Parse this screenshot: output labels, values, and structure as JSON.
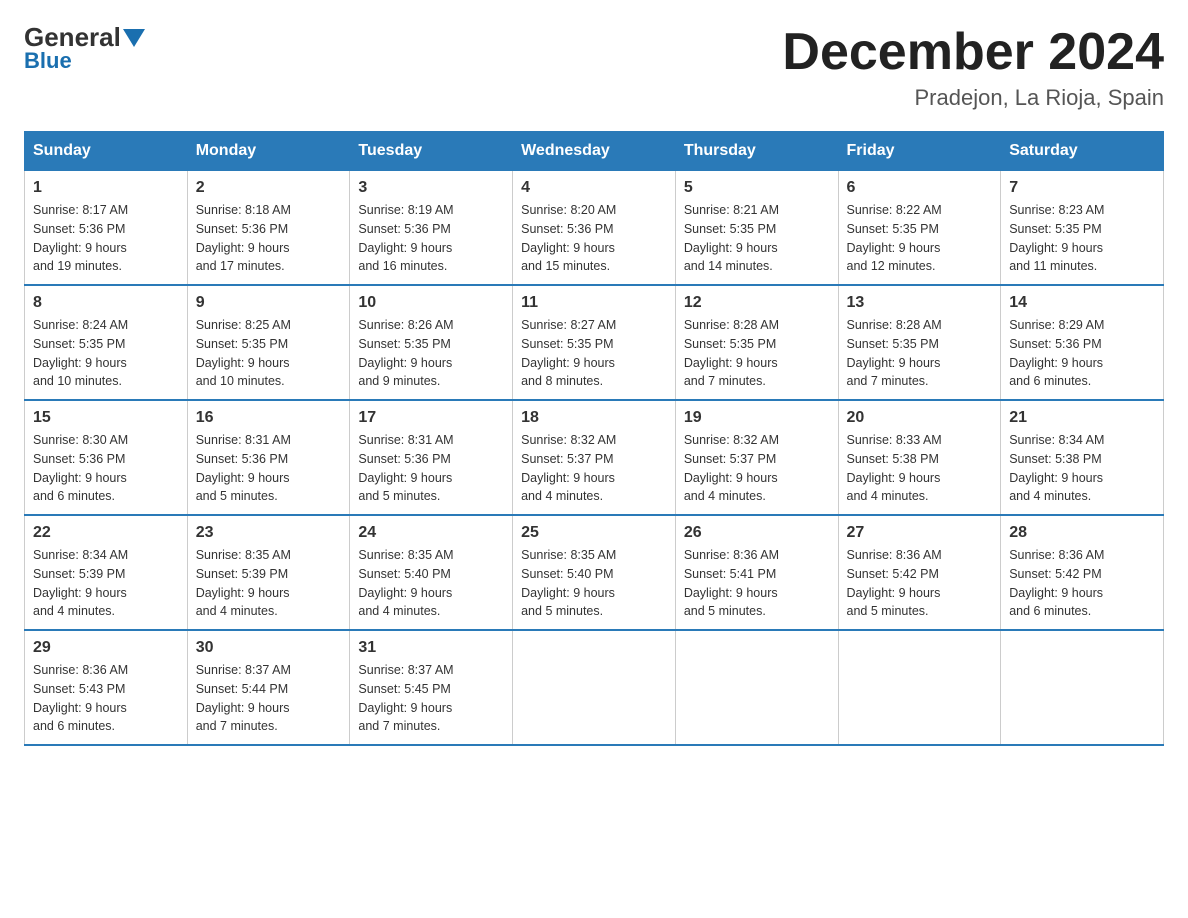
{
  "logo": {
    "general": "General",
    "blue": "Blue"
  },
  "header": {
    "month": "December 2024",
    "location": "Pradejon, La Rioja, Spain"
  },
  "days_of_week": [
    "Sunday",
    "Monday",
    "Tuesday",
    "Wednesday",
    "Thursday",
    "Friday",
    "Saturday"
  ],
  "weeks": [
    [
      {
        "day": "1",
        "sunrise": "8:17 AM",
        "sunset": "5:36 PM",
        "daylight": "9 hours and 19 minutes."
      },
      {
        "day": "2",
        "sunrise": "8:18 AM",
        "sunset": "5:36 PM",
        "daylight": "9 hours and 17 minutes."
      },
      {
        "day": "3",
        "sunrise": "8:19 AM",
        "sunset": "5:36 PM",
        "daylight": "9 hours and 16 minutes."
      },
      {
        "day": "4",
        "sunrise": "8:20 AM",
        "sunset": "5:36 PM",
        "daylight": "9 hours and 15 minutes."
      },
      {
        "day": "5",
        "sunrise": "8:21 AM",
        "sunset": "5:35 PM",
        "daylight": "9 hours and 14 minutes."
      },
      {
        "day": "6",
        "sunrise": "8:22 AM",
        "sunset": "5:35 PM",
        "daylight": "9 hours and 12 minutes."
      },
      {
        "day": "7",
        "sunrise": "8:23 AM",
        "sunset": "5:35 PM",
        "daylight": "9 hours and 11 minutes."
      }
    ],
    [
      {
        "day": "8",
        "sunrise": "8:24 AM",
        "sunset": "5:35 PM",
        "daylight": "9 hours and 10 minutes."
      },
      {
        "day": "9",
        "sunrise": "8:25 AM",
        "sunset": "5:35 PM",
        "daylight": "9 hours and 10 minutes."
      },
      {
        "day": "10",
        "sunrise": "8:26 AM",
        "sunset": "5:35 PM",
        "daylight": "9 hours and 9 minutes."
      },
      {
        "day": "11",
        "sunrise": "8:27 AM",
        "sunset": "5:35 PM",
        "daylight": "9 hours and 8 minutes."
      },
      {
        "day": "12",
        "sunrise": "8:28 AM",
        "sunset": "5:35 PM",
        "daylight": "9 hours and 7 minutes."
      },
      {
        "day": "13",
        "sunrise": "8:28 AM",
        "sunset": "5:35 PM",
        "daylight": "9 hours and 7 minutes."
      },
      {
        "day": "14",
        "sunrise": "8:29 AM",
        "sunset": "5:36 PM",
        "daylight": "9 hours and 6 minutes."
      }
    ],
    [
      {
        "day": "15",
        "sunrise": "8:30 AM",
        "sunset": "5:36 PM",
        "daylight": "9 hours and 6 minutes."
      },
      {
        "day": "16",
        "sunrise": "8:31 AM",
        "sunset": "5:36 PM",
        "daylight": "9 hours and 5 minutes."
      },
      {
        "day": "17",
        "sunrise": "8:31 AM",
        "sunset": "5:36 PM",
        "daylight": "9 hours and 5 minutes."
      },
      {
        "day": "18",
        "sunrise": "8:32 AM",
        "sunset": "5:37 PM",
        "daylight": "9 hours and 4 minutes."
      },
      {
        "day": "19",
        "sunrise": "8:32 AM",
        "sunset": "5:37 PM",
        "daylight": "9 hours and 4 minutes."
      },
      {
        "day": "20",
        "sunrise": "8:33 AM",
        "sunset": "5:38 PM",
        "daylight": "9 hours and 4 minutes."
      },
      {
        "day": "21",
        "sunrise": "8:34 AM",
        "sunset": "5:38 PM",
        "daylight": "9 hours and 4 minutes."
      }
    ],
    [
      {
        "day": "22",
        "sunrise": "8:34 AM",
        "sunset": "5:39 PM",
        "daylight": "9 hours and 4 minutes."
      },
      {
        "day": "23",
        "sunrise": "8:35 AM",
        "sunset": "5:39 PM",
        "daylight": "9 hours and 4 minutes."
      },
      {
        "day": "24",
        "sunrise": "8:35 AM",
        "sunset": "5:40 PM",
        "daylight": "9 hours and 4 minutes."
      },
      {
        "day": "25",
        "sunrise": "8:35 AM",
        "sunset": "5:40 PM",
        "daylight": "9 hours and 5 minutes."
      },
      {
        "day": "26",
        "sunrise": "8:36 AM",
        "sunset": "5:41 PM",
        "daylight": "9 hours and 5 minutes."
      },
      {
        "day": "27",
        "sunrise": "8:36 AM",
        "sunset": "5:42 PM",
        "daylight": "9 hours and 5 minutes."
      },
      {
        "day": "28",
        "sunrise": "8:36 AM",
        "sunset": "5:42 PM",
        "daylight": "9 hours and 6 minutes."
      }
    ],
    [
      {
        "day": "29",
        "sunrise": "8:36 AM",
        "sunset": "5:43 PM",
        "daylight": "9 hours and 6 minutes."
      },
      {
        "day": "30",
        "sunrise": "8:37 AM",
        "sunset": "5:44 PM",
        "daylight": "9 hours and 7 minutes."
      },
      {
        "day": "31",
        "sunrise": "8:37 AM",
        "sunset": "5:45 PM",
        "daylight": "9 hours and 7 minutes."
      },
      null,
      null,
      null,
      null
    ]
  ],
  "labels": {
    "sunrise": "Sunrise:",
    "sunset": "Sunset:",
    "daylight": "Daylight:"
  }
}
